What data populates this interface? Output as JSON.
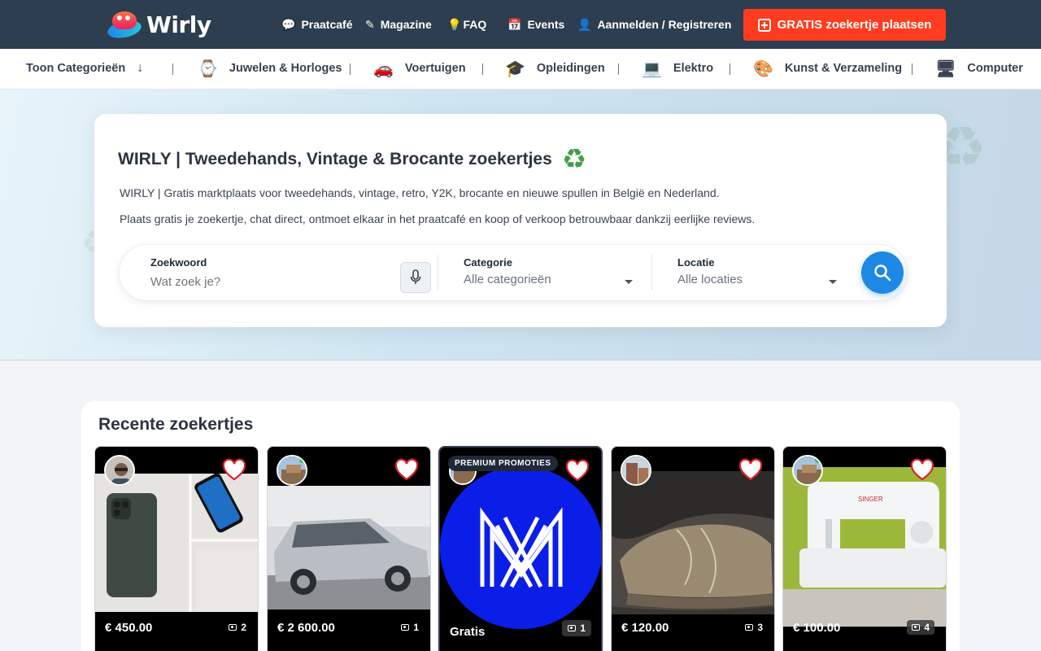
{
  "brand": {
    "name": "Wirly"
  },
  "nav": [
    {
      "icon": "chat-bubble-icon",
      "glyph": "💬",
      "label": "Praatcafé"
    },
    {
      "icon": "pencil-icon",
      "glyph": "✎",
      "label": "Magazine"
    },
    {
      "icon": "lightbulb-icon",
      "glyph": "💡",
      "label": "FAQ"
    },
    {
      "icon": "calendar-icon",
      "glyph": "📅",
      "label": "Events"
    },
    {
      "icon": "user-circle-icon",
      "glyph": "👤",
      "label": "Aanmelden / Registreren"
    }
  ],
  "cta": {
    "label": "GRATIS zoekertje plaatsen"
  },
  "categories": {
    "toggle_label": "Toon Categorieën",
    "items": [
      {
        "icon": "watch-icon",
        "glyph": "⌚",
        "label": "Juwelen & Horloges"
      },
      {
        "icon": "car-icon",
        "glyph": "🚗",
        "label": "Voertuigen"
      },
      {
        "icon": "graduation-cap-icon",
        "glyph": "🎓",
        "label": "Opleidingen"
      },
      {
        "icon": "laptop-icon",
        "glyph": "💻",
        "label": "Elektro"
      },
      {
        "icon": "palette-icon",
        "glyph": "🎨",
        "label": "Kunst & Verzameling"
      },
      {
        "icon": "desktop-icon",
        "glyph": "🖥",
        "label": "Computer"
      }
    ]
  },
  "hero": {
    "title": "WIRLY | Tweedehands, Vintage & Brocante zoekertjes",
    "title_icon": "♻",
    "paragraph1": "WIRLY | Gratis marktplaats voor tweedehands, vintage, retro, Y2K, brocante en nieuwe spullen in België en Nederland.",
    "paragraph2": "Plaats gratis je zoekertje, chat direct, ontmoet elkaar in het praatcafé en koop of verkoop betrouwbaar dankzij eerlijke reviews."
  },
  "search": {
    "keyword_label": "Zoekwoord",
    "keyword_placeholder": "Wat zoek je?",
    "category_label": "Categorie",
    "category_value": "Alle categorieën",
    "location_label": "Locatie",
    "location_value": "Alle locaties"
  },
  "recent": {
    "title": "Recente zoekertjes",
    "listings": [
      {
        "price": "€ 450.00",
        "photos": "2",
        "subject": "phone"
      },
      {
        "price": "€ 2 600.00",
        "photos": "1",
        "subject": "car"
      },
      {
        "price": "Gratis",
        "photos": "1",
        "subject": "logo",
        "badge": "PREMIUM PROMOTIES"
      },
      {
        "price": "€ 120.00",
        "photos": "3",
        "subject": "shoes"
      },
      {
        "price": "€ 100.00",
        "photos": "4",
        "subject": "sewing-machine"
      }
    ]
  },
  "colors": {
    "topbar": "#2c3e50",
    "cta": "#ff3c1f",
    "search_button": "#1e88e5",
    "heart": "#e11d2a"
  }
}
